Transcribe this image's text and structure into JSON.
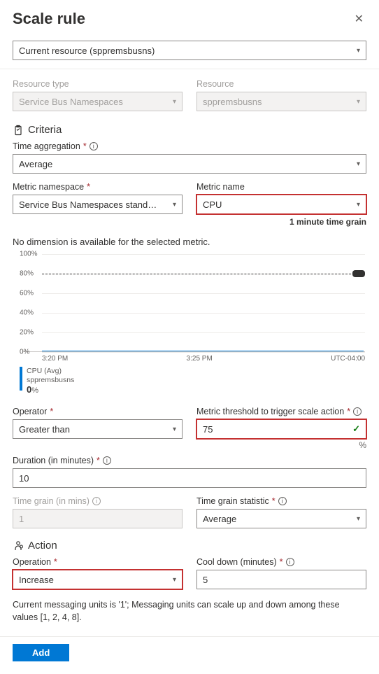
{
  "header": {
    "title": "Scale rule"
  },
  "resourceBar": {
    "value": "Current resource (sppremsbusns)"
  },
  "fields": {
    "resourceType": {
      "label": "Resource type",
      "value": "Service Bus Namespaces"
    },
    "resource": {
      "label": "Resource",
      "value": "sppremsbusns"
    },
    "criteriaHeader": "Criteria",
    "timeAggregation": {
      "label": "Time aggregation",
      "value": "Average"
    },
    "metricNamespace": {
      "label": "Metric namespace",
      "value": "Service Bus Namespaces standard me..."
    },
    "metricName": {
      "label": "Metric name",
      "value": "CPU",
      "grainHint": "1 minute time grain"
    },
    "noDimension": "No dimension is available for the selected metric.",
    "operator": {
      "label": "Operator",
      "value": "Greater than"
    },
    "threshold": {
      "label": "Metric threshold to trigger scale action",
      "value": "75",
      "unit": "%"
    },
    "duration": {
      "label": "Duration (in minutes)",
      "value": "10"
    },
    "timeGrain": {
      "label": "Time grain (in mins)",
      "value": "1"
    },
    "timeGrainStat": {
      "label": "Time grain statistic",
      "value": "Average"
    },
    "actionHeader": "Action",
    "operation": {
      "label": "Operation",
      "value": "Increase"
    },
    "cooldown": {
      "label": "Cool down (minutes)",
      "value": "5"
    },
    "footnote": "Current messaging units is '1'; Messaging units can scale up and down among these values [1, 2, 4, 8]."
  },
  "chart_data": {
    "type": "line",
    "yticks": [
      "0%",
      "20%",
      "40%",
      "60%",
      "80%",
      "100%"
    ],
    "xticks": [
      "3:20 PM",
      "3:25 PM",
      "UTC-04:00"
    ],
    "threshold_pct": 80,
    "series": [
      {
        "name": "CPU (Avg)",
        "resource": "sppremsbusns",
        "current_value": 0,
        "unit": "%",
        "approx_value_pct": 1
      }
    ]
  },
  "buttons": {
    "add": "Add"
  }
}
